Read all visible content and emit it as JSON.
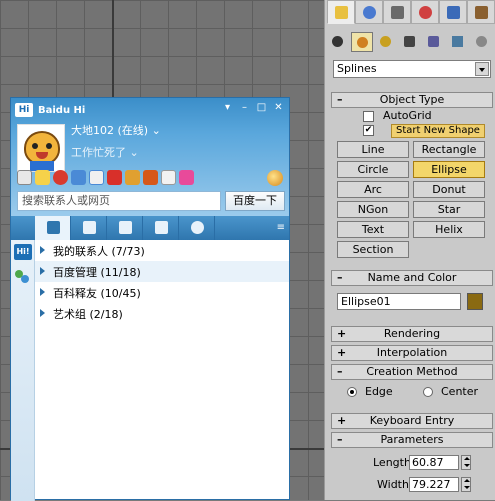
{
  "baidu_hi": {
    "title": "Baidu Hi",
    "logo_text": "Hi",
    "nickname": "大地102 (在线)",
    "nickname_caret": "⌄",
    "signature": "工作忙死了",
    "signature_caret": "⌄",
    "search_placeholder": "搜索联系人或网页",
    "search_button": "百度一下",
    "side_logo_text": "Hi!",
    "tab_menu_icon": "≡",
    "groups": [
      {
        "label": "我的联系人 (7/73)"
      },
      {
        "label": "百度管理 (11/18)"
      },
      {
        "label": "百科释友 (10/45)"
      },
      {
        "label": "艺术组 (2/18)"
      }
    ]
  },
  "max_panel": {
    "category": "Splines",
    "object_type": {
      "header": "Object Type",
      "autogrid": "AutoGrid",
      "start_new_shape": "Start New Shape",
      "buttons": [
        "Line",
        "Rectangle",
        "Circle",
        "Ellipse",
        "Arc",
        "Donut",
        "NGon",
        "Star",
        "Text",
        "Helix",
        "Section"
      ],
      "active": "Ellipse"
    },
    "name_and_color": {
      "header": "Name and Color",
      "name": "Ellipse01",
      "color": "#8a6a12"
    },
    "rendering": "Rendering",
    "interpolation": "Interpolation",
    "creation_method": {
      "header": "Creation Method",
      "edge": "Edge",
      "center": "Center",
      "selected": "Edge"
    },
    "keyboard_entry": "Keyboard Entry",
    "parameters": {
      "header": "Parameters",
      "length_label": "Length:",
      "length_value": "60.87",
      "width_label": "Width:",
      "width_value": "79.227"
    },
    "checked_mark": "✔",
    "plus": "+",
    "minus": "–"
  }
}
